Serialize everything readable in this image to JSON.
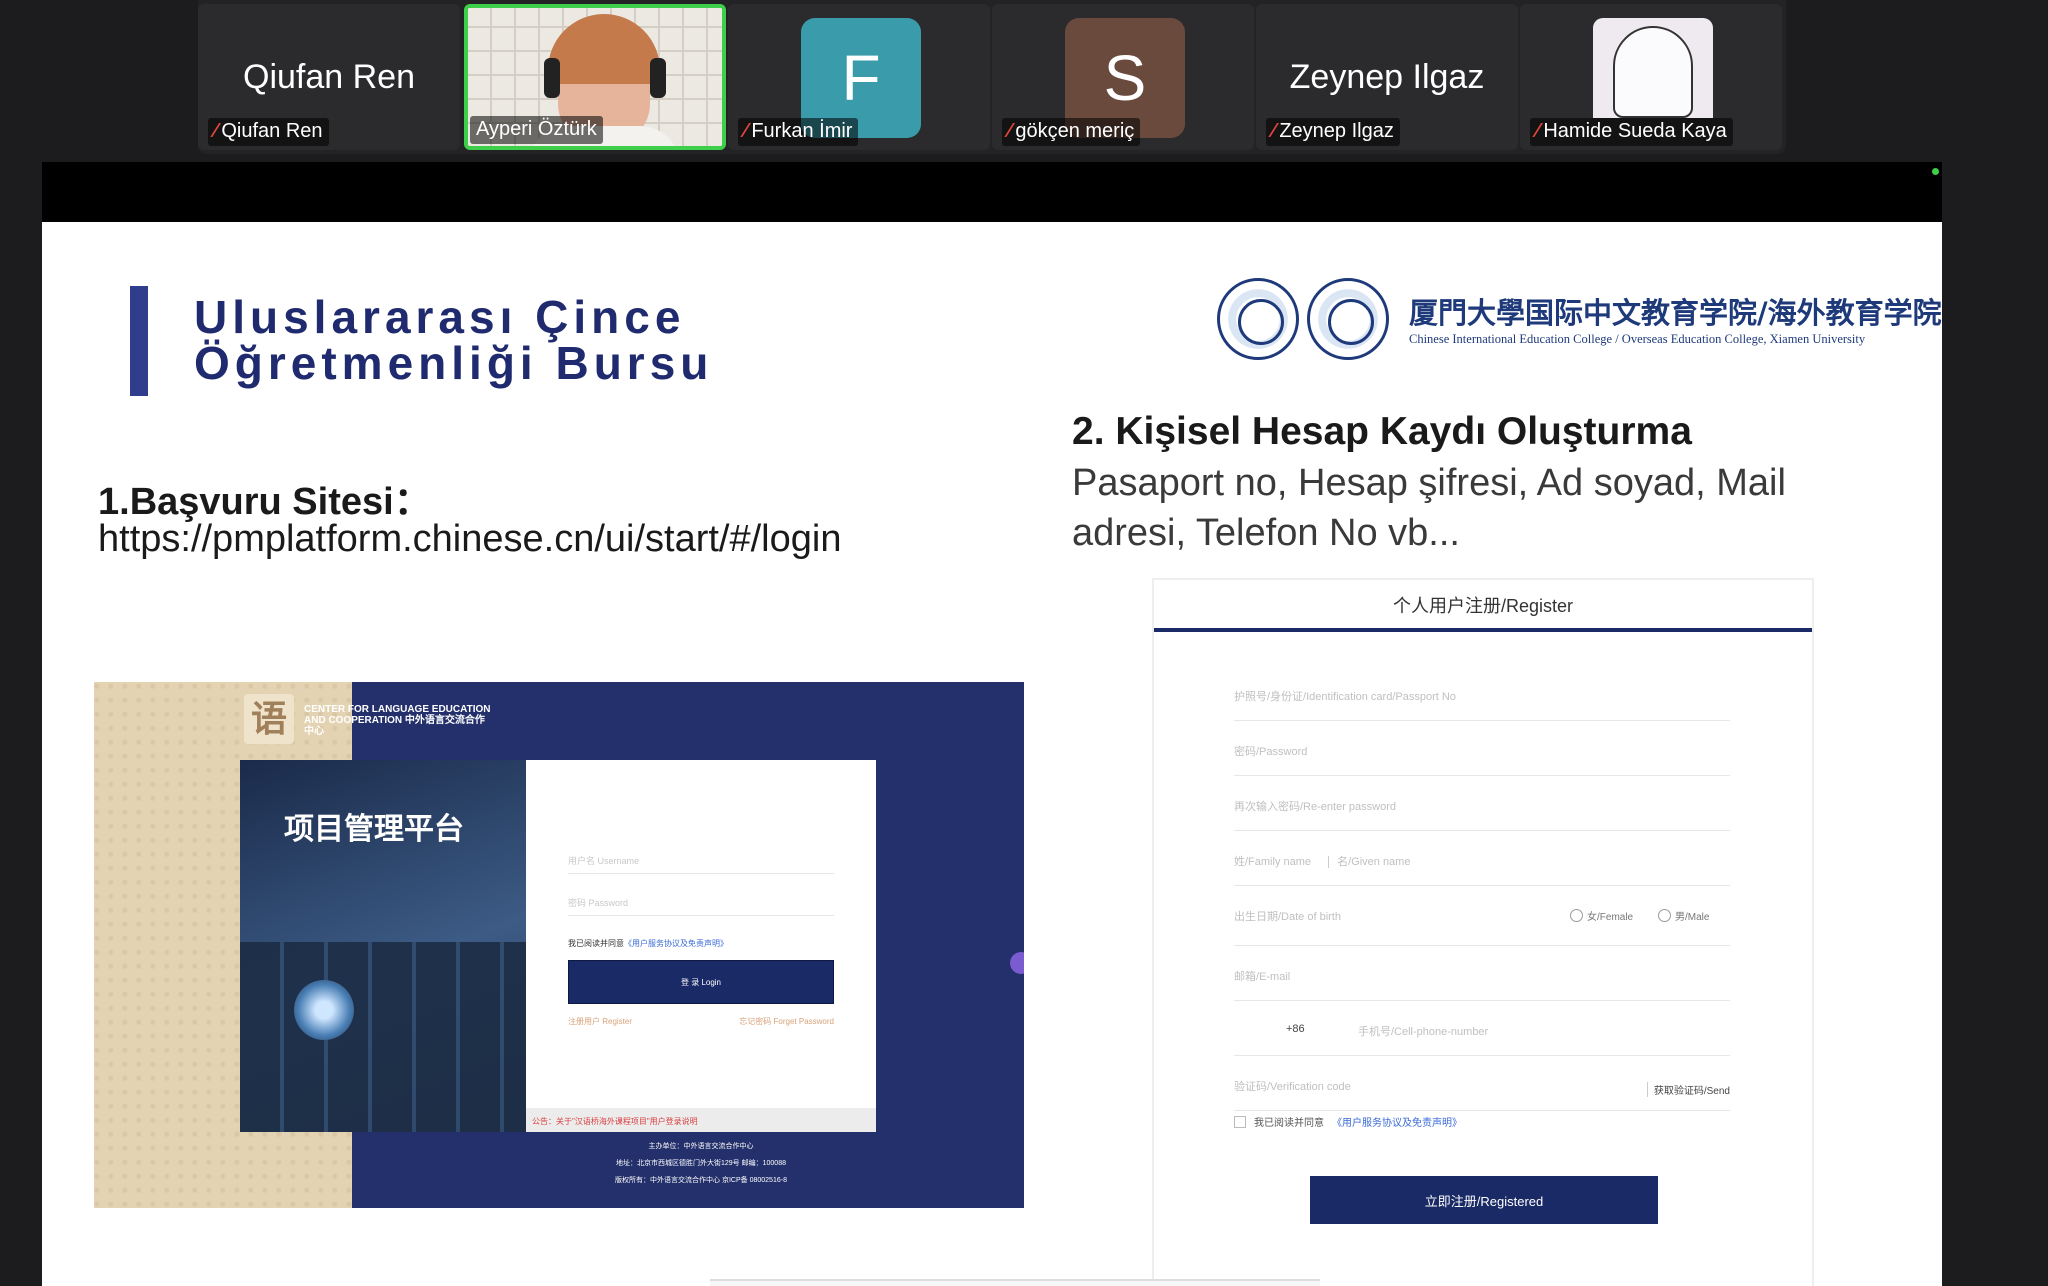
{
  "participants": [
    {
      "display_name": "Qiufan Ren",
      "label": "Qiufan Ren",
      "type": "name",
      "muted": true
    },
    {
      "display_name": "",
      "label": "Ayperi Öztürk",
      "type": "video",
      "muted": false,
      "active_speaker": true
    },
    {
      "display_name": "F",
      "label": "Furkan İmir",
      "type": "avatar",
      "avatar_color": "#3a9bab",
      "muted": true
    },
    {
      "display_name": "S",
      "label": "gökçen meriç",
      "type": "avatar",
      "avatar_color": "#6b4a3e",
      "muted": true
    },
    {
      "display_name": "Zeynep Ilgaz",
      "label": "Zeynep Ilgaz",
      "type": "name",
      "muted": true
    },
    {
      "display_name": "",
      "label": "Hamide Sueda Kaya",
      "type": "image",
      "muted": true
    }
  ],
  "icons": {
    "muted": "mic-muted-icon"
  },
  "slide": {
    "title_line1": "Uluslararası Çince",
    "title_line2": "Öğretmenliği Bursu",
    "university_cn": "厦門大學国际中文教育学院/海外教育学院",
    "university_en": "Chinese International Education College / Overseas Education College, Xiamen University",
    "section1_heading": "1.Başvuru Sitesi：",
    "section1_url": "https://pmplatform.chinese.cn/ui/start/#/login",
    "section2_heading": "2. Kişisel Hesap Kaydı Oluşturma",
    "section2_desc": "Pasaport no, Hesap şifresi, Ad soyad, Mail adresi, Telefon No vb...",
    "login_shot": {
      "logo_text": "CENTER FOR LANGUAGE EDUCATION AND COOPERATION 中外语言交流合作中心",
      "logo_glyph": "语",
      "platform_title": "项目管理平台",
      "username_placeholder": "用户名 Username",
      "password_placeholder": "密码 Password",
      "agree_text": "我已阅读并同意",
      "agree_link": "《用户服务协议及免责声明》",
      "login_button": "登 录 Login",
      "register_link": "注册用户 Register",
      "forgot_link": "忘记密码 Forget Password",
      "notice": "公告：关于\"汉语桥海外课程项目\"用户登录说明",
      "footer_line1": "主办单位：中外语言交流合作中心",
      "footer_line2": "地址：北京市西城区德胜门外大街129号 邮编：100088",
      "footer_line3": "版权所有：中外语言交流合作中心 京ICP备 08002516-8"
    },
    "register_shot": {
      "title": "个人用户注册/Register",
      "id_placeholder": "护照号/身份证/Identification card/Passport No",
      "password_placeholder": "密码/Password",
      "reenter_placeholder": "再次输入密码/Re-enter password",
      "family_name_placeholder": "姓/Family name",
      "given_name_placeholder": "名/Given name",
      "dob_placeholder": "出生日期/Date of birth",
      "female_label": "女/Female",
      "male_label": "男/Male",
      "email_placeholder": "邮箱/E-mail",
      "country_code": "+86",
      "phone_placeholder": "手机号/Cell-phone-number",
      "code_placeholder": "验证码/Verification code",
      "send_button": "获取验证码/Send",
      "agree_text": "我已阅读并同意",
      "agree_link": "《用户服务协议及免责声明》",
      "register_button": "立即注册/Registered"
    }
  }
}
